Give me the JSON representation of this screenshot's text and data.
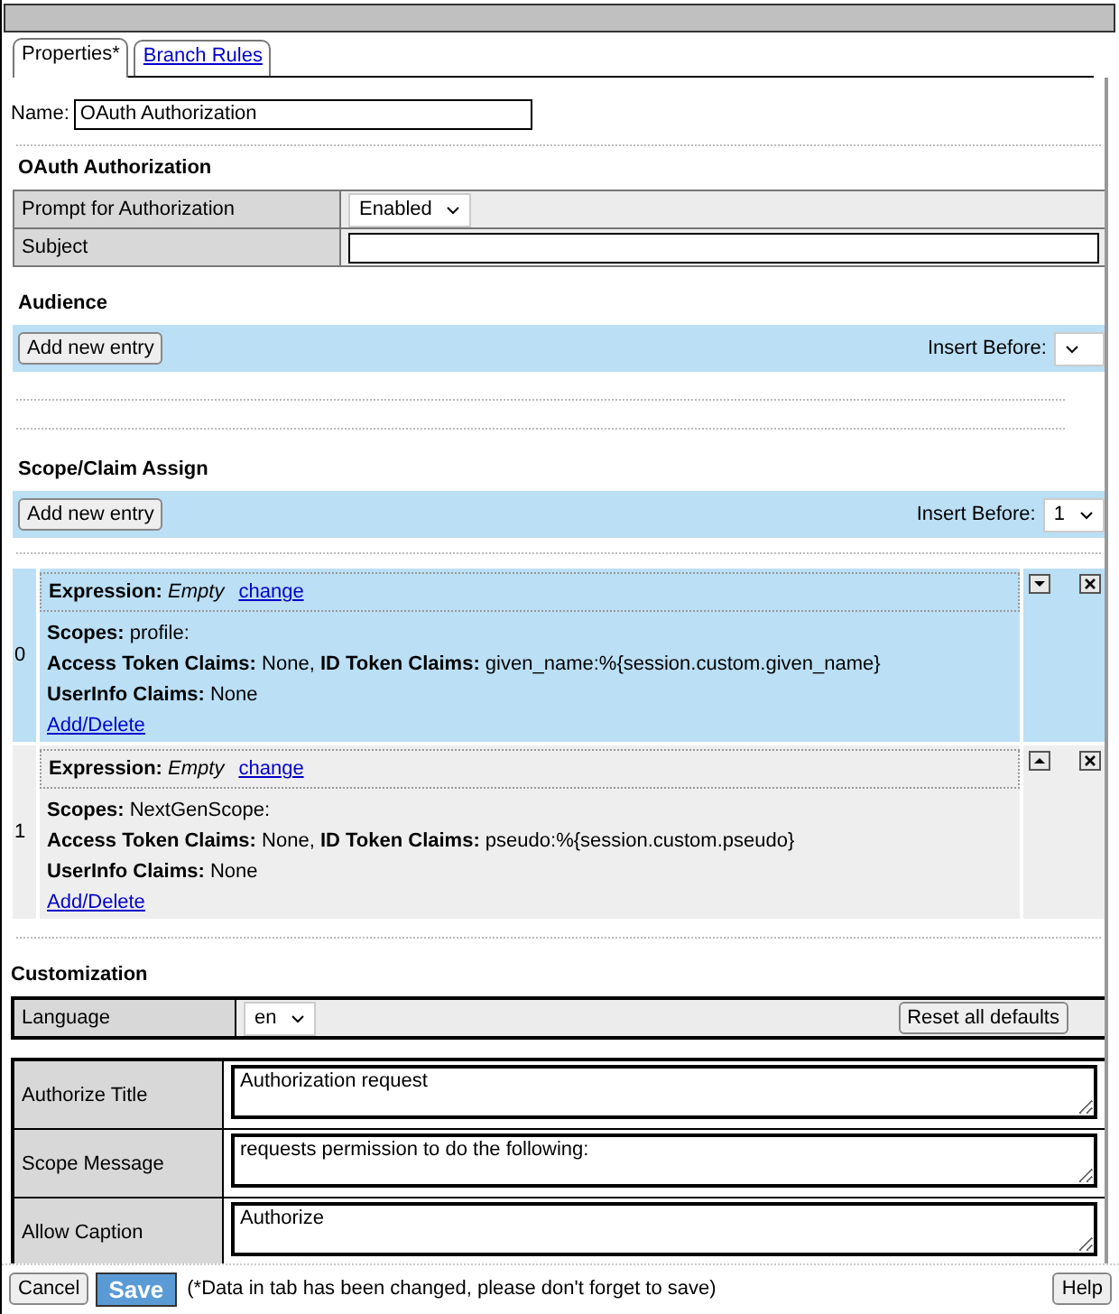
{
  "tabs": [
    {
      "label": "Properties*",
      "selected": true
    },
    {
      "label": "Branch Rules",
      "selected": false
    }
  ],
  "name": {
    "label": "Name:",
    "value": "OAuth Authorization"
  },
  "oauth": {
    "title": "OAuth Authorization",
    "rows": [
      {
        "label": "Prompt for Authorization",
        "kind": "select",
        "value": "Enabled"
      },
      {
        "label": "Subject",
        "kind": "text"
      }
    ]
  },
  "audience": {
    "title": "Audience",
    "add_button": "Add new entry",
    "insert_label": "Insert Before:"
  },
  "scope": {
    "title": "Scope/Claim Assign",
    "add_button": "Add new entry",
    "insert_label": "Insert Before:",
    "insert_value": "1",
    "entries": [
      {
        "index": "0",
        "selected": true,
        "kind": "down",
        "expression_label": "Expression:",
        "expression": "Empty",
        "change": "change",
        "lines": [
          "**Scopes:** profile:",
          "**Access Token Claims:** None, **ID Token Claims:** given_name:%{session.custom.given_name}",
          "**UserInfo Claims:** None"
        ],
        "link": "Add/Delete"
      },
      {
        "index": "1",
        "selected": false,
        "kind": "up",
        "expression_label": "Expression:",
        "expression": "Empty",
        "change": "change",
        "lines": [
          "**Scopes:** NextGenScope:",
          "**Access Token Claims:** None, **ID Token Claims:** pseudo:%{session.custom.pseudo}",
          "**UserInfo Claims:** None"
        ],
        "link": "Add/Delete"
      }
    ]
  },
  "customization": {
    "title": "Customization",
    "language_label": "Language",
    "language": "en",
    "reset_button": "Reset all defaults",
    "fields": [
      {
        "label": "Authorize Title",
        "value": "Authorization request"
      },
      {
        "label": "Scope Message",
        "value": "requests permission to do the following:"
      },
      {
        "label": "Allow Caption",
        "value": "Authorize"
      }
    ]
  },
  "footer": {
    "cancel": "Cancel",
    "save": "Save",
    "note": "(*Data in tab has been changed, please don't forget to save)",
    "help": "Help"
  }
}
